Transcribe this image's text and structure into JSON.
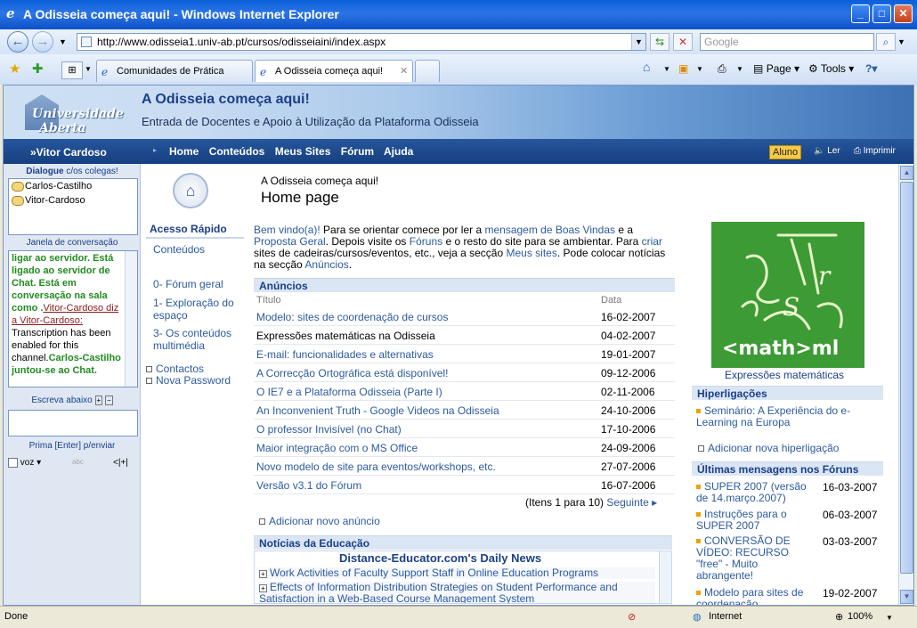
{
  "window": {
    "title": "A Odisseia começa aqui! - Windows Internet Explorer",
    "address": "http://www.odisseia1.univ-ab.pt/cursos/odisseiaini/index.aspx",
    "search_placeholder": "Google"
  },
  "tabs": [
    {
      "label": "Comunidades de Prática"
    },
    {
      "label": "A Odisseia começa aqui!"
    }
  ],
  "toolbar": {
    "page": "Page",
    "tools": "Tools"
  },
  "header": {
    "logo_line1": "Universidade",
    "logo_line2": "Aberta",
    "title": "A Odisseia começa aqui!",
    "subtitle": "Entrada de Docentes e Apoio à Utilização da Plataforma Odisseia"
  },
  "nav": {
    "user": "»Vitor Cardoso",
    "menu": [
      "Home",
      "Conteúdos",
      "Meus Sites",
      "Fórum",
      "Ajuda"
    ],
    "role": "Aluno",
    "read": "Ler",
    "print": "Imprimir"
  },
  "chat": {
    "dialogue_title": "Dialogue",
    "dialogue_suffix": "c/os colegas!",
    "users": [
      "Carlos-Castilho",
      "Vitor-Cardoso"
    ],
    "window_title": "Janela de conversação",
    "msg1": "ligar ao servidor. Está ligado ao servidor de Chat. Está em conversação na sala como .",
    "msg1_user": "Vitor-Cardoso diz a Vitor-Cardoso:",
    "msg2": " Transcription has been enabled for this channel.",
    "msg3": "Carlos-Castilho juntou-se ao Chat.",
    "write_below": "Escreva abaixo",
    "send_hint": "Prima [Enter] p/enviar",
    "voice": "voz",
    "abc": "abc"
  },
  "page": {
    "subtitle": "A Odisseia começa aqui!",
    "title": "Home page"
  },
  "quick": {
    "title": "Acesso Rápido",
    "items": [
      "Conteúdos",
      "0- Fórum geral",
      "1- Exploração do espaço",
      "3- Os conteúdos multimédia"
    ],
    "contacts": "Contactos",
    "password": "Nova Password"
  },
  "welcome": {
    "p1": "Bem vindo(a)!",
    "p2": " Para se orientar comece por ler a ",
    "p3": "mensagem de Boas Vindas",
    "p4": " e a ",
    "p5": "Proposta Geral",
    "p6": ". Depois visite os ",
    "p7": "Fóruns",
    "p8": " e o resto do site para se ambientar. Para ",
    "p9": "criar",
    "p10": "  sites de cadeiras/cursos/eventos, etc., veja a secção ",
    "p11": "Meus sites",
    "p12": ". Pode colocar notícias na secção ",
    "p13": "Anúncios",
    "p14": "."
  },
  "announcements": {
    "title": "Anúncios",
    "col_title": "Título",
    "col_date": "Data",
    "rows": [
      {
        "title": "Modelo: sites de coordenação de cursos",
        "date": "16-02-2007"
      },
      {
        "title": "Expressões matemáticas na Odisseia",
        "date": "04-02-2007"
      },
      {
        "title": "E-mail: funcionalidades e alternativas",
        "date": "19-01-2007"
      },
      {
        "title": "A Correcção Ortográfica está disponível!",
        "date": "09-12-2006"
      },
      {
        "title": "O IE7 e a Plataforma Odisseia (Parte I)",
        "date": "02-11-2006"
      },
      {
        "title": "An Inconvenient Truth - Google Videos na Odisseia",
        "date": "24-10-2006"
      },
      {
        "title": "O professor Invisível (no Chat)",
        "date": "17-10-2006"
      },
      {
        "title": "Maior integração com o MS Office",
        "date": "24-09-2006"
      },
      {
        "title": "Novo modelo de site para eventos/workshops, etc.",
        "date": "27-07-2006"
      },
      {
        "title": "Versão v3.1 do Fórum",
        "date": "16-07-2006"
      }
    ],
    "items_info": "(Itens 1 para 10)",
    "next": "Seguinte ▸",
    "add": "Adicionar novo anúncio"
  },
  "news": {
    "title": "Notícias da Educação",
    "source": "Distance-Educator.com's Daily News",
    "items": [
      "Work Activities of Faculty Support Staff in Online Education Programs",
      "Effects of Information Distribution Strategies on Student Performance and Satisfaction in a Web-Based Course Management System"
    ]
  },
  "sidebar": {
    "image_caption": "Expressões matemáticas",
    "mathml_label": "<math>ml",
    "links_title": "Hiperligações",
    "links": [
      "Seminário: A Experiência do e-Learning na Europa"
    ],
    "add_link": "Adicionar nova hiperligação",
    "forum_title": "Últimas mensagens nos Fóruns",
    "forum": [
      {
        "title": "SUPER 2007 (versão de 14.março.2007)",
        "date": "16-03-2007"
      },
      {
        "title": "Instruções para o SUPER 2007",
        "date": "06-03-2007"
      },
      {
        "title": "CONVERSÃO DE VÍDEO: RECURSO \"free\" - Muito abrangente!",
        "date": "03-03-2007"
      },
      {
        "title": "Modelo para sites de coordenação",
        "date": "19-02-2007"
      }
    ]
  },
  "status": {
    "left": "Done",
    "zone": "Internet",
    "zoom": "100%"
  }
}
